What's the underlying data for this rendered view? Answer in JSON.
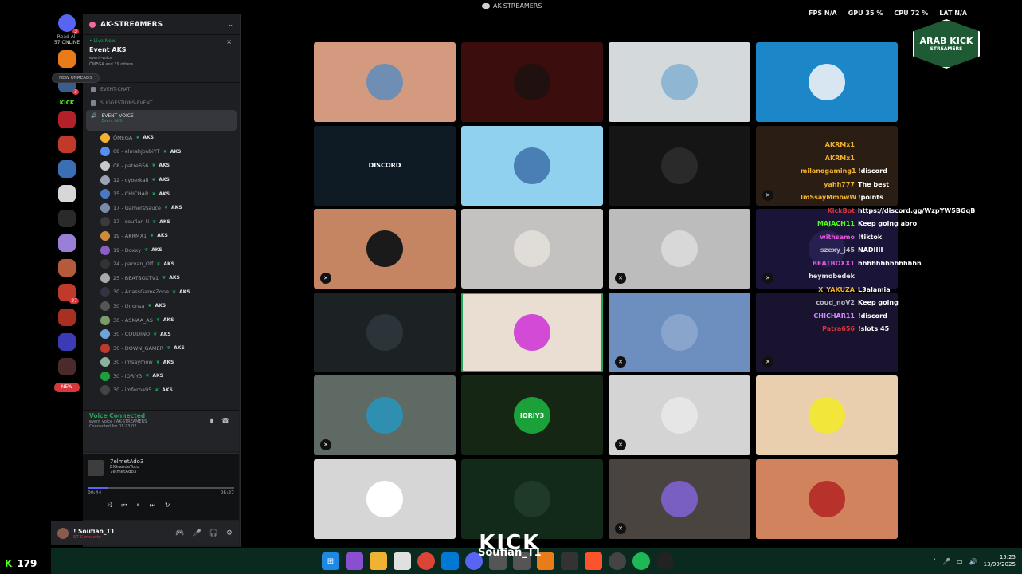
{
  "top": {
    "title": "AK-STREAMERS"
  },
  "stats": {
    "fps": "FPS N/A",
    "gpu": "GPU 35 %",
    "cpu": "CPU 72 %",
    "lat": "LAT N/A"
  },
  "rail": {
    "read_all": "Read All",
    "online": "57 ONLINE",
    "kick": "KICK",
    "new": "NEW",
    "badge_dm": "3",
    "badge_2": "3",
    "badge_3": "27"
  },
  "server": {
    "name": "AK-STREAMERS",
    "live_now": "• Live Now",
    "event_title": "Event AKS",
    "live_sub1": "event-voice",
    "live_sub2": "ÔMEGA",
    "live_sub3": "and 39 others",
    "close": "×"
  },
  "new_unreads": "NEW UNREADS",
  "channels": [
    {
      "name": "EVENT-CHAT"
    },
    {
      "name": "SUGGESTIONS-EVENT"
    }
  ],
  "active_channel": {
    "name": "EVENT VOICE",
    "sub": "Event AKS"
  },
  "users": [
    {
      "name": "ÔMEGA",
      "tag": "AKS",
      "color": "#f0b232"
    },
    {
      "name": "08 - elmahjoubiYT",
      "tag": "AKS",
      "color": "#5b8def"
    },
    {
      "name": "08 - patre656",
      "tag": "AKS",
      "color": "#c9c9c9"
    },
    {
      "name": "12 - cyberkali",
      "tag": "AKS",
      "color": "#9aa4b5"
    },
    {
      "name": "15 - CHICHAR",
      "tag": "AKS",
      "color": "#4a78c2"
    },
    {
      "name": "17 - GamersSauce",
      "tag": "AKS",
      "color": "#7a8aa8"
    },
    {
      "name": "17 - soufian-ti",
      "tag": "AKS",
      "color": "#3b3b3b"
    },
    {
      "name": "19 - AKRMX1",
      "tag": "AKS",
      "color": "#d08a3a"
    },
    {
      "name": "19 - Doxxy",
      "tag": "AKS",
      "color": "#8a5fc2"
    },
    {
      "name": "24 - parvan_Off",
      "tag": "AKS",
      "color": "#333"
    },
    {
      "name": "25 - BEATBOXTV1",
      "tag": "AKS",
      "color": "#aaa"
    },
    {
      "name": "30 - AnassGameZone",
      "tag": "AKS",
      "color": "#334"
    },
    {
      "name": "30 - thronsa",
      "tag": "AKS",
      "color": "#555"
    },
    {
      "name": "30 - ASMAA_AS",
      "tag": "AKS",
      "color": "#7b9c6a"
    },
    {
      "name": "30 - COUDINO",
      "tag": "AKS",
      "color": "#6fa3d9"
    },
    {
      "name": "30 - DOWN_GAMER",
      "tag": "AKS",
      "color": "#c0392b"
    },
    {
      "name": "30 - imsaymow",
      "tag": "AKS",
      "color": "#8fb0a0"
    },
    {
      "name": "30 - IORIY3",
      "tag": "AKS",
      "color": "#1ba03a"
    },
    {
      "name": "30 - imferba95",
      "tag": "AKS",
      "color": "#444"
    }
  ],
  "voice": {
    "title": "Voice Connected",
    "sub1": "event voice / AK-STREAMERS",
    "sub2": "Connected for 01:23:02"
  },
  "music": {
    "track": "7elmetAdo3",
    "artist1": "ElGrandeToto",
    "artist2": "7elmetAdo3",
    "elapsed": "00:44",
    "total": "05:27",
    "progress": 0.14
  },
  "userbar": {
    "name": "! Soufian_T1",
    "status": "ST Comunity"
  },
  "kick_corner": {
    "count": "179"
  },
  "tiles": [
    {
      "bg": "#d49a7f",
      "av": "#6e8fb3",
      "label": ""
    },
    {
      "bg": "#3b0d0d",
      "av": "#201010",
      "label": ""
    },
    {
      "bg": "#d4dadc",
      "av": "#8fb7d4",
      "label": ""
    },
    {
      "bg": "#1b86c8",
      "av": "#d7e6f0",
      "label": ""
    },
    {
      "bg": "#0e1a24",
      "av": "#0e1a24",
      "label": "DISCORD"
    },
    {
      "bg": "#8fd1ef",
      "av": "#4a7fb5",
      "label": ""
    },
    {
      "bg": "#151515",
      "av": "#2a2a2a",
      "label": ""
    },
    {
      "bg": "#2a1d14",
      "av": "#2a1d14",
      "label": "",
      "mute": true
    },
    {
      "bg": "#c68562",
      "av": "#1a1a1a",
      "label": "",
      "mute": true
    },
    {
      "bg": "#c4c2c1",
      "av": "#e0dcd8",
      "label": ""
    },
    {
      "bg": "#bcbcbc",
      "av": "#d8d8d8",
      "label": "",
      "mute": true
    },
    {
      "bg": "#1a1538",
      "av": "#262050",
      "label": "",
      "mute": true
    },
    {
      "bg": "#1c2224",
      "av": "#2b3539",
      "label": ""
    },
    {
      "bg": "#eaddd2",
      "av": "#d24ad6",
      "label": "",
      "speaking": true
    },
    {
      "bg": "#6d8fbf",
      "av": "#8aa5cc",
      "label": "",
      "mute": true
    },
    {
      "bg": "#1a1330",
      "av": "#1a1330",
      "label": "",
      "mute": true
    },
    {
      "bg": "#5f6a64",
      "av": "#2e8fb0",
      "label": "",
      "mute": true
    },
    {
      "bg": "#152615",
      "av": "#1ba03a",
      "label": "IORIY3"
    },
    {
      "bg": "#d4d4d4",
      "av": "#e6e6e6",
      "label": "",
      "mute": true
    },
    {
      "bg": "#e9cfae",
      "av": "#f2e63a",
      "label": ""
    },
    {
      "bg": "#d6d6d6",
      "av": "#ffffff",
      "label": ""
    },
    {
      "bg": "#112a1a",
      "av": "#1f3b28",
      "label": ""
    },
    {
      "bg": "#4a4441",
      "av": "#7a5fc2",
      "label": "",
      "mute": true
    },
    {
      "bg": "#d0835c",
      "av": "#b8322c",
      "label": ""
    }
  ],
  "chat": [
    {
      "n": "AKRMx1",
      "m": "",
      "c": "#f0b232"
    },
    {
      "n": "AKRMx1",
      "m": "",
      "c": "#f0b232"
    },
    {
      "n": "milanogaming1",
      "m": "!discord",
      "c": "#f0b232"
    },
    {
      "n": "yahh777",
      "m": "The best",
      "c": "#f0b232"
    },
    {
      "n": "ImSsayMmowW",
      "m": "!points",
      "c": "#f0b232"
    },
    {
      "n": "KickBot",
      "m": "https://discord.gg/WzpYW5BGqB",
      "c": "#da373c"
    },
    {
      "n": "MAJACH11",
      "m": "Keep going abro",
      "c": "#53fc18"
    },
    {
      "n": "withsamo",
      "m": "!tiktok",
      "c": "#e05ad6"
    },
    {
      "n": "szexy_j45",
      "m": "NADIIII",
      "c": "#b5bac1"
    },
    {
      "n": "BEATBOXX1",
      "m": "hhhhhhhhhhhhhh",
      "c": "#e05ad6"
    },
    {
      "n": "heymobedek",
      "m": "",
      "c": "#e0e0e0"
    },
    {
      "n": "X_YAKUZA",
      "m": "L3alamia",
      "c": "#f0b232"
    },
    {
      "n": "coud_noV2",
      "m": "Keep going",
      "c": "#b5bac1"
    },
    {
      "n": "CHICHAR11",
      "m": "!discord",
      "c": "#d08aff"
    },
    {
      "n": "Patra656",
      "m": "!slots 45",
      "c": "#da373c"
    }
  ],
  "logo": {
    "line1": "ARAB KICK",
    "line2": "STREAMERS"
  },
  "overlay": {
    "kick": "KICK",
    "name": "Soufian_T1"
  },
  "clock": {
    "time": "15:25",
    "date": "13/09/2025"
  }
}
